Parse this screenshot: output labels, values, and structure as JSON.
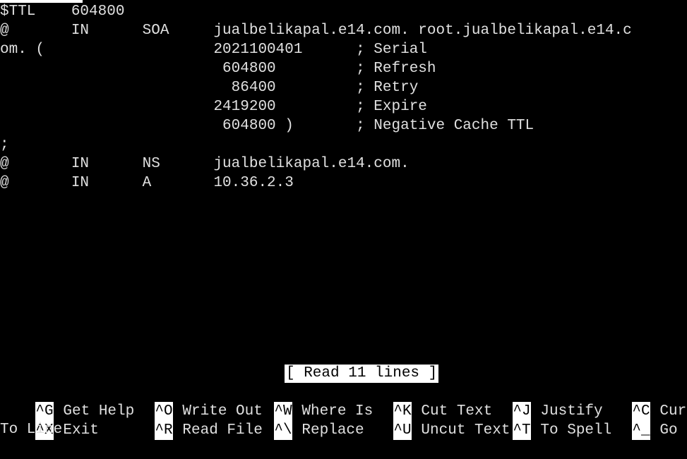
{
  "window": {
    "title": ""
  },
  "editor": {
    "lines": [
      "$TTL    604800",
      "@       IN      SOA     jualbelikapal.e14.com. root.jualbelikapal.e14.c",
      "om. (                   2021100401      ; Serial",
      "                         604800         ; Refresh",
      "                          86400         ; Retry",
      "                        2419200         ; Expire",
      "                         604800 )       ; Negative Cache TTL",
      ";",
      "@       IN      NS      jualbelikapal.e14.com.",
      "@       IN      A       10.36.2.3"
    ]
  },
  "status": {
    "message": "[ Read 11 lines ]"
  },
  "shortcuts": {
    "row1": [
      {
        "key": "^G",
        "label": "Get Help"
      },
      {
        "key": "^O",
        "label": "Write Out"
      },
      {
        "key": "^W",
        "label": "Where Is"
      },
      {
        "key": "^K",
        "label": "Cut Text"
      },
      {
        "key": "^J",
        "label": "Justify"
      },
      {
        "key": "^C",
        "label": "Cur"
      }
    ],
    "row2": [
      {
        "key": "^X",
        "label": "Exit"
      },
      {
        "key": "^R",
        "label": "Read File"
      },
      {
        "key": "^\\",
        "label": "Replace"
      },
      {
        "key": "^U",
        "label": "Uncut Text"
      },
      {
        "key": "^T",
        "label": "To Spell"
      },
      {
        "key": "^_",
        "label": "Go"
      }
    ],
    "wrap_text": "To Line"
  }
}
